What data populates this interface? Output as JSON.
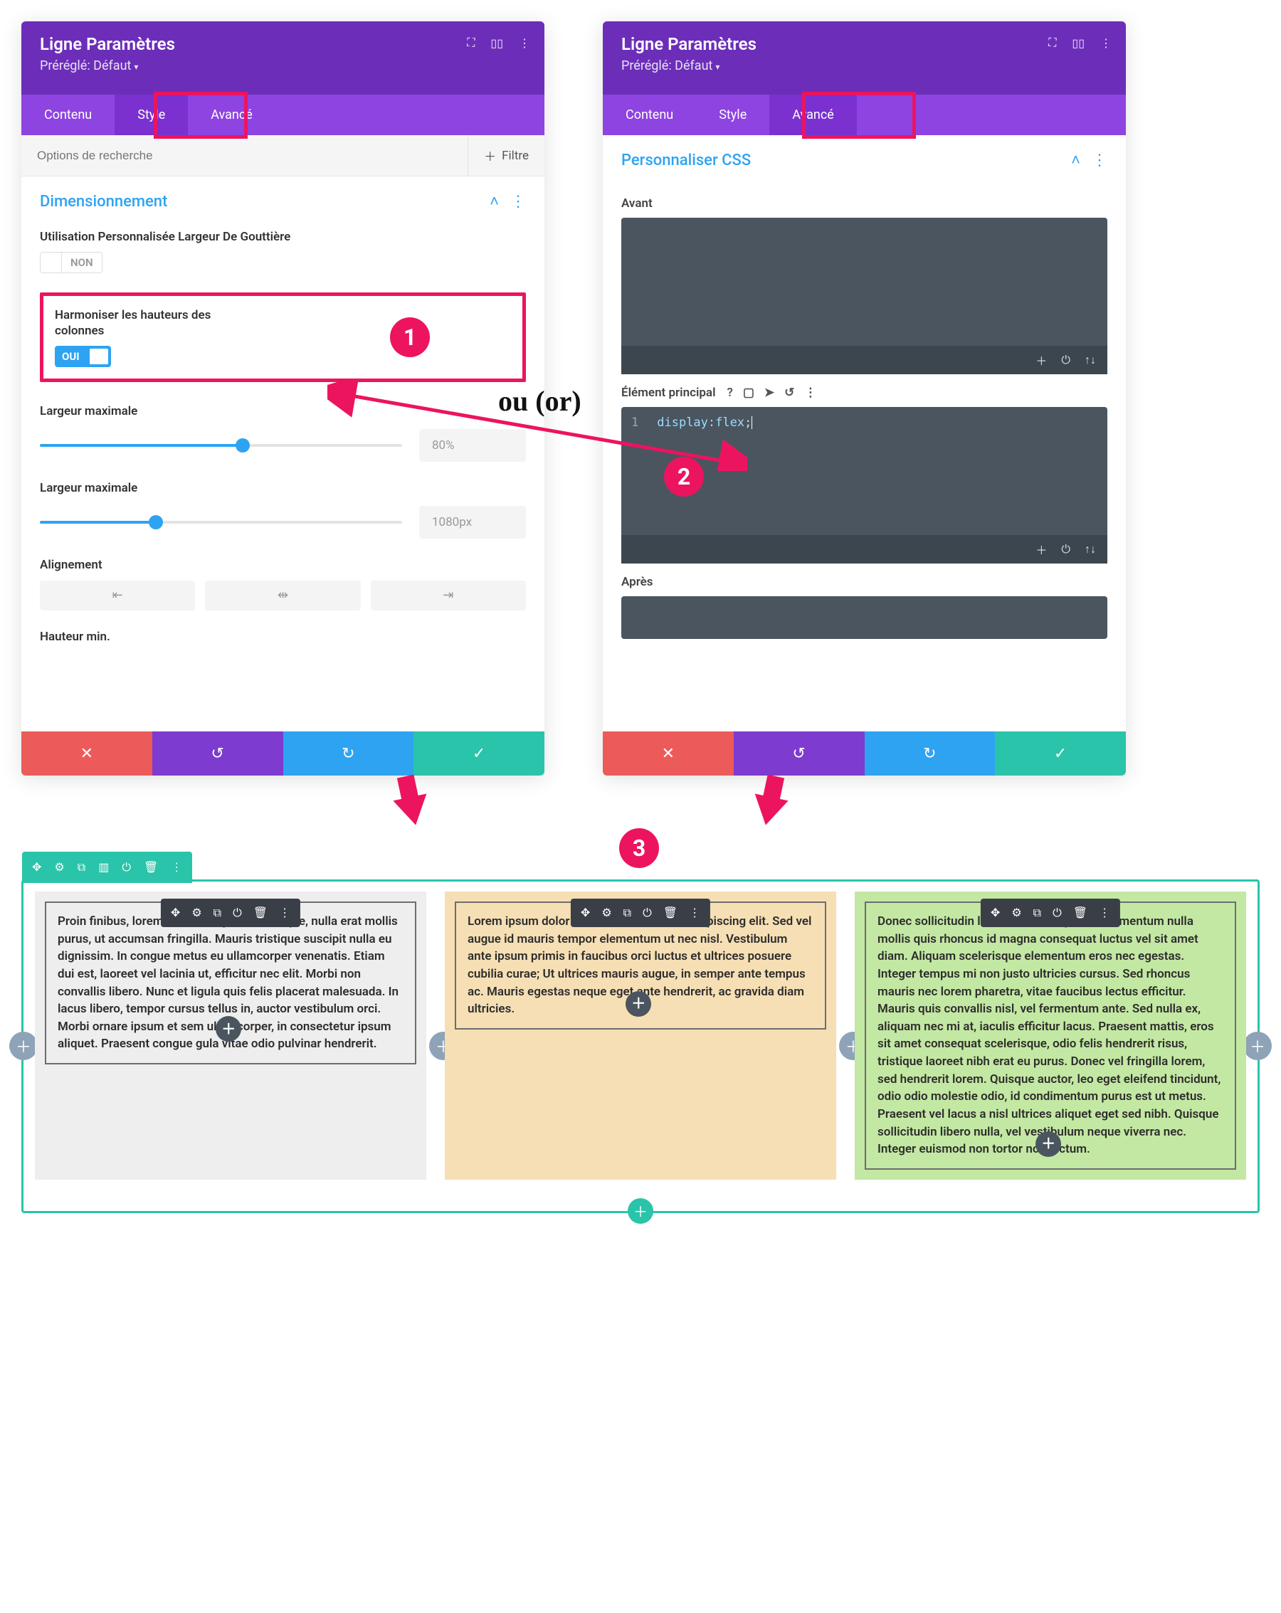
{
  "panels": {
    "left": {
      "title": "Ligne Paramètres",
      "preset_label": "Préréglé: Défaut",
      "tabs": {
        "content": "Contenu",
        "style": "Style",
        "advanced": "Avancé"
      },
      "search_placeholder": "Options de recherche",
      "filter_label": "Filtre",
      "section": "Dimensionnement",
      "gutter_label": "Utilisation Personnalisée Largeur De Gouttière",
      "toggle_non": "NON",
      "equalize_label": "Harmoniser les hauteurs des colonnes",
      "toggle_oui": "OUI",
      "max_width_1_label": "Largeur maximale",
      "max_width_1_value": "80%",
      "max_width_2_label": "Largeur maximale",
      "max_width_2_value": "1080px",
      "alignment_label": "Alignement",
      "min_height_label": "Hauteur min."
    },
    "right": {
      "title": "Ligne Paramètres",
      "preset_label": "Préréglé: Défaut",
      "tabs": {
        "content": "Contenu",
        "style": "Style",
        "advanced": "Avancé"
      },
      "section": "Personnaliser CSS",
      "before_label": "Avant",
      "main_label": "Élément principal",
      "after_label": "Après",
      "code_line_num": "1",
      "code_prop": "display:",
      "code_val": "flex",
      "code_semicolon": ";"
    }
  },
  "annotations": {
    "or_text": "ou (or)",
    "step1": "1",
    "step2": "2",
    "step3": "3"
  },
  "builder": {
    "col1_text": "Proin finibus, lorem vitae volutpat scelerisque, nulla erat mollis purus, ut accumsan fringilla. Mauris tristique suscipit nulla eu dignissim. In congue metus eu ullamcorper venenatis. Etiam dui est, laoreet vel lacinia ut, efficitur nec elit. Morbi non convallis libero. Nunc et ligula quis felis placerat malesuada. In lacus libero, tempor cursus tellus in, auctor vestibulum orci. Morbi ornare ipsum et sem ullamcorper, in consectetur ipsum aliquet. Praesent congue gula vitae odio pulvinar hendrerit.",
    "col2_text": "Lorem ipsum dolor sit amet, consectetur adipiscing elit. Sed vel augue id mauris tempor elementum ut nec nisl. Vestibulum ante ipsum primis in faucibus orci luctus et ultrices posuere cubilia curae; Ut ultrices mauris augue, in semper ante tempus ac. Mauris egestas neque eget ante hendrerit, ac gravida diam ultricies.",
    "col3_text": "Donec sollicitudin lorem ac erat sapien, a elementum nulla mollis quis rhoncus id magna consequat luctus vel sit amet diam. Aliquam scelerisque elementum eros nec egestas. Integer tempus mi non justo ultricies cursus. Sed rhoncus mauris nec lorem pharetra, vitae faucibus lectus efficitur. Mauris quis convallis nisl, vel fermentum ante. Sed nulla ex, aliquam nec mi at, iaculis efficitur lacus. Praesent mattis, eros sit amet consequat scelerisque, odio felis hendrerit risus, tristique laoreet nibh erat eu purus. Donec vel fringilla lorem, sed hendrerit lorem. Quisque auctor, leo eget eleifend tincidunt, odio odio molestie odio, id condimentum purus est ut metus. Praesent vel lacus a nisl ultrices aliquet eget sed nibh. Quisque sollicitudin libero nulla, vel vestibulum neque viverra nec. Integer euismod non tortor non dictum."
  }
}
